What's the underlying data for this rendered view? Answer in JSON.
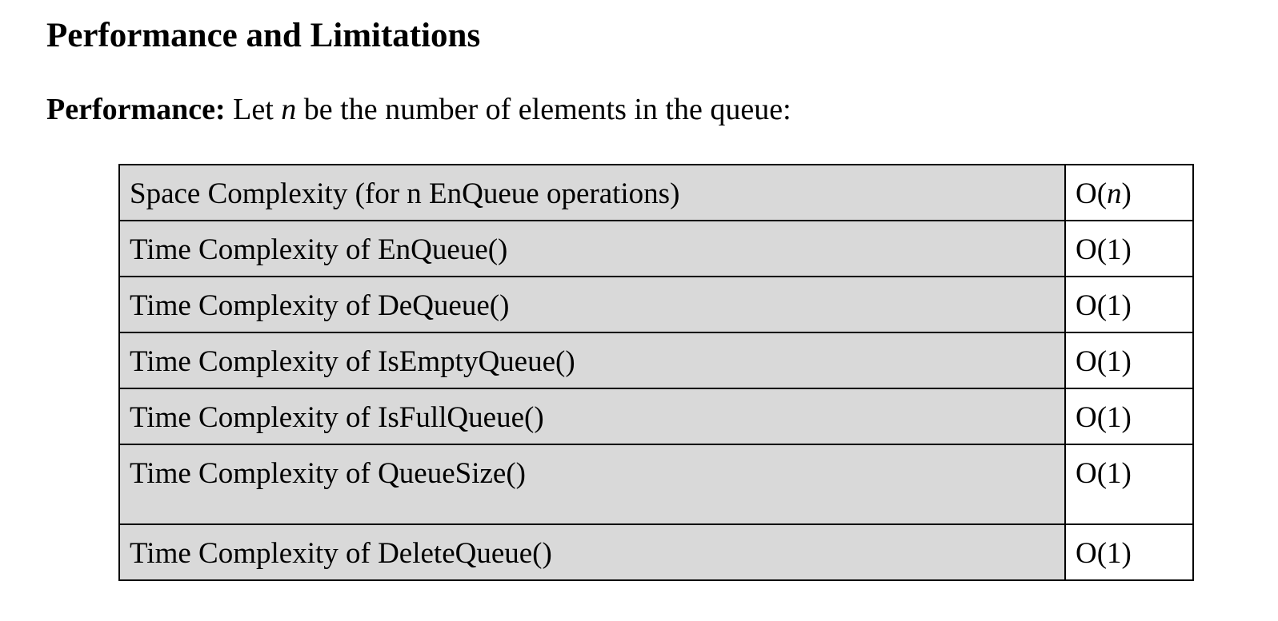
{
  "heading": "Performance and Limitations",
  "intro": {
    "bold_label": "Performance:",
    "text_before": " Let ",
    "var": "n",
    "text_after": " be the number of elements in the queue:"
  },
  "table": {
    "rows": [
      {
        "label": "Space Complexity (for n EnQueue operations)",
        "value_prefix": "O(",
        "value_var": "n",
        "value_suffix": ")"
      },
      {
        "label": "Time Complexity of EnQueue()",
        "value": "O(1)"
      },
      {
        "label": "Time Complexity of DeQueue()",
        "value": "O(1)"
      },
      {
        "label": "Time Complexity of IsEmptyQueue()",
        "value": "O(1)"
      },
      {
        "label": "Time Complexity of IsFullQueue()",
        "value": "O(1)"
      },
      {
        "label": "Time Complexity of QueueSize()",
        "value": "O(1)"
      },
      {
        "label": "Time Complexity of DeleteQueue()",
        "value": "O(1)"
      }
    ],
    "label_bg": "#d9d9d9",
    "border_color": "#000000"
  }
}
